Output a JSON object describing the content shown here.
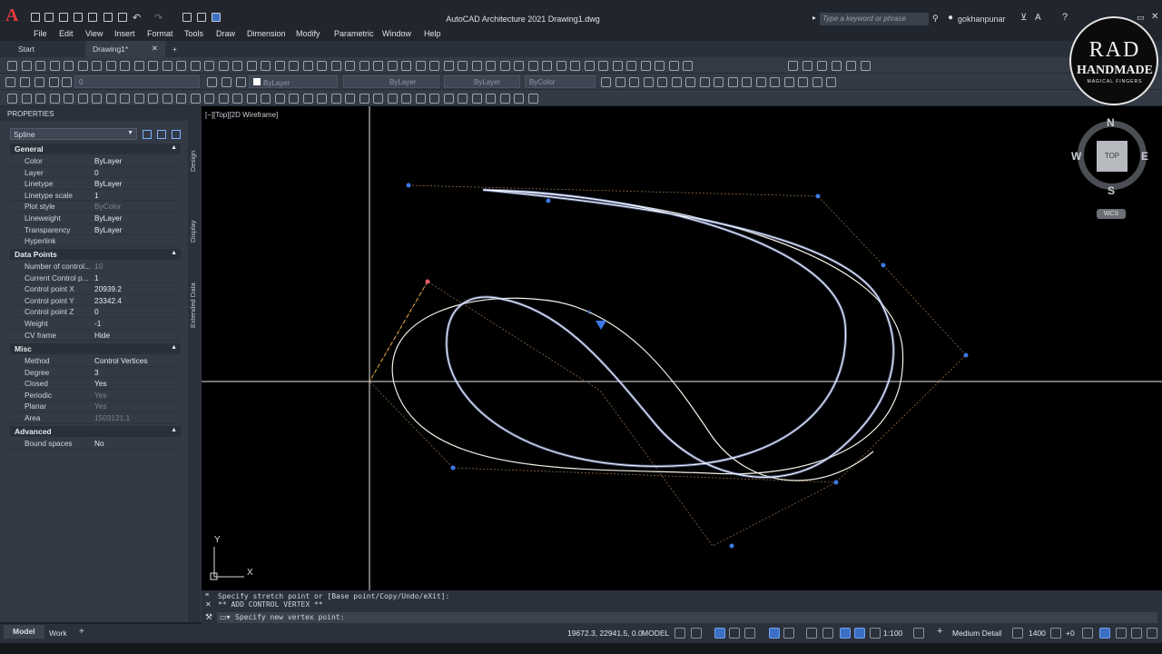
{
  "app": {
    "title": "AutoCAD Architecture 2021    Drawing1.dwg",
    "search_placeholder": "Type a keyword or phrase",
    "user": "gokhanpunar"
  },
  "menu": [
    "File",
    "Edit",
    "View",
    "Insert",
    "Format",
    "Tools",
    "Draw",
    "Dimension",
    "Modify",
    "Parametric",
    "Window",
    "Help"
  ],
  "file_tabs": {
    "start": "Start",
    "drawing": "Drawing1*",
    "add": "+"
  },
  "toolbar2": {
    "layer": "0",
    "color": "ByLayer",
    "linetype": "ByLayer",
    "lineweight": "ByLayer",
    "plotstyle": "ByColor"
  },
  "properties": {
    "header": "PROPERTIES",
    "object_type": "Spline",
    "side_tabs": [
      "Design",
      "Display",
      "Extended Data"
    ],
    "sections": {
      "general": "General",
      "data_points": "Data Points",
      "misc": "Misc",
      "advanced": "Advanced"
    },
    "general": [
      {
        "k": "Color",
        "v": "ByLayer"
      },
      {
        "k": "Layer",
        "v": "0"
      },
      {
        "k": "Linetype",
        "v": "ByLayer"
      },
      {
        "k": "Linetype scale",
        "v": "1"
      },
      {
        "k": "Plot style",
        "v": "ByColor"
      },
      {
        "k": "Lineweight",
        "v": "ByLayer"
      },
      {
        "k": "Transparency",
        "v": "ByLayer"
      },
      {
        "k": "Hyperlink",
        "v": ""
      }
    ],
    "data_points": [
      {
        "k": "Number of control...",
        "v": "10"
      },
      {
        "k": "Current Control p...",
        "v": "1"
      },
      {
        "k": "Control point X",
        "v": "20939.2"
      },
      {
        "k": "Control point Y",
        "v": "23342.4"
      },
      {
        "k": "Control point Z",
        "v": "0"
      },
      {
        "k": "Weight",
        "v": "-1"
      },
      {
        "k": "CV frame",
        "v": "Hide"
      }
    ],
    "misc": [
      {
        "k": "Method",
        "v": "Control Vertices"
      },
      {
        "k": "Degree",
        "v": "3"
      },
      {
        "k": "Closed",
        "v": "Yes"
      },
      {
        "k": "Periodic",
        "v": "Yes"
      },
      {
        "k": "Planar",
        "v": "Yes"
      },
      {
        "k": "Area",
        "v": "1503121.1"
      }
    ],
    "advanced": [
      {
        "k": "Bound spaces",
        "v": "No"
      }
    ]
  },
  "viewport": {
    "label": "[−][Top][2D Wireframe]",
    "viewcube": {
      "n": "N",
      "s": "S",
      "e": "E",
      "w": "W",
      "top": "TOP",
      "wcs": "WCS"
    },
    "ucs": {
      "x": "X",
      "y": "Y"
    }
  },
  "command": {
    "line1": "Specify stretch point or [Base point/Copy/Undo/eXit]:",
    "line2": "** ADD CONTROL VERTEX **",
    "prompt": "Specify new vertex point:"
  },
  "status": {
    "model_tab": "Model",
    "work_tab": "Work",
    "coords": "19672.3, 22941.5, 0.0",
    "model": "MODEL",
    "scale": "1:100",
    "detail": "Medium Detail",
    "elevation": "1400",
    "offset": "+0"
  },
  "watermark": {
    "line1": "RAD",
    "line2": "HANDMADE",
    "line3": "MAGICAL FINGERS"
  }
}
